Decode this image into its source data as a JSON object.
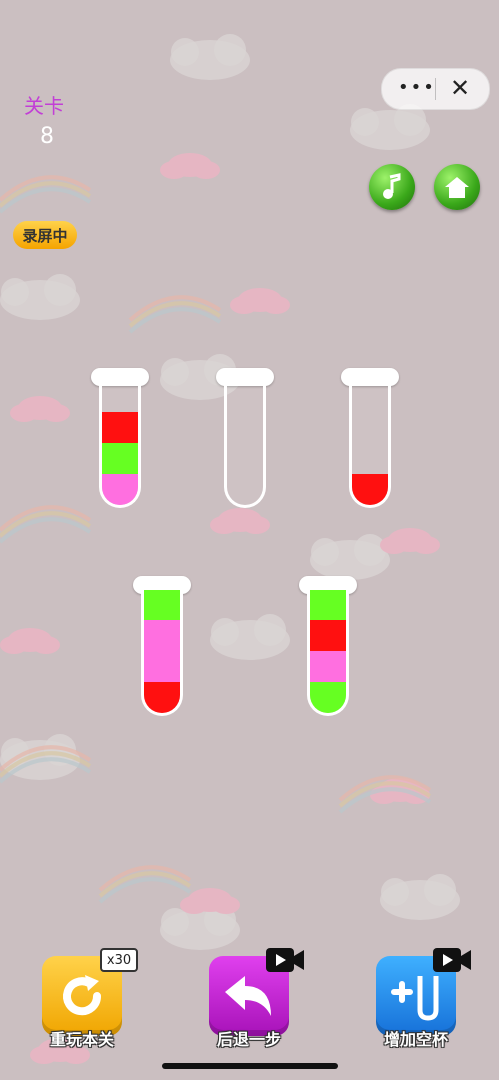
{
  "colors": {
    "red": "#ff1010",
    "green": "#66ff22",
    "pink": "#ff6fe0",
    "level_label": "#c23fd6"
  },
  "level": {
    "label": "关卡",
    "number": "8"
  },
  "capsule": {
    "more_icon": "more-dots-icon",
    "close_icon": "close-icon"
  },
  "top_buttons": [
    {
      "name": "music",
      "icon": "music-note-icon"
    },
    {
      "name": "home",
      "icon": "home-icon"
    }
  ],
  "recording_badge": "录屏中",
  "tubes": [
    {
      "layers_bottom_to_top": [
        "pink",
        "green",
        "red"
      ]
    },
    {
      "layers_bottom_to_top": []
    },
    {
      "layers_bottom_to_top": [
        "red"
      ]
    },
    {
      "layers_bottom_to_top": [
        "red",
        "pink",
        "pink",
        "green"
      ]
    },
    {
      "layers_bottom_to_top": [
        "green",
        "pink",
        "red",
        "green"
      ]
    }
  ],
  "tools": [
    {
      "label": "重玩本关",
      "badge": "x30",
      "icon": "restart-icon",
      "color": "#f5b400"
    },
    {
      "label": "后退一步",
      "badge_icon": "video-camera-icon",
      "icon": "undo-arrow-icon",
      "color": "#c21fd2"
    },
    {
      "label": "增加空杯",
      "badge_icon": "video-camera-icon",
      "icon": "add-tube-icon",
      "color": "#1e8ee8"
    }
  ]
}
